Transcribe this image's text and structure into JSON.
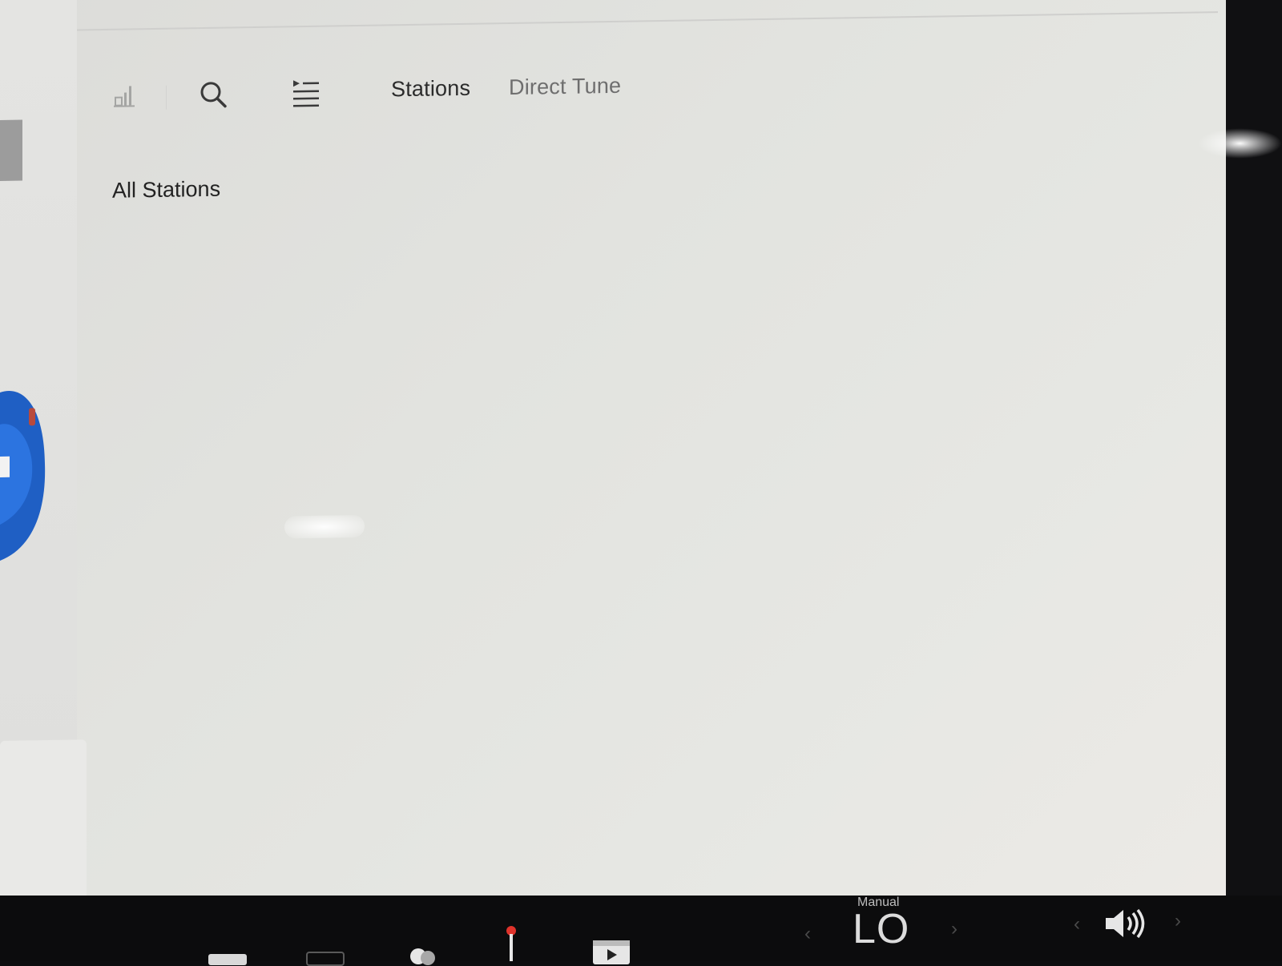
{
  "toolbar": {
    "icons": [
      "equalizer-icon",
      "search-icon",
      "queue-icon"
    ],
    "tabs": [
      {
        "label": "Stations",
        "active": true
      },
      {
        "label": "Direct Tune",
        "active": false
      }
    ]
  },
  "content": {
    "section_heading": "All Stations"
  },
  "bottom_bar": {
    "climate": {
      "mode_label": "Manual",
      "temperature": "LO"
    },
    "volume_icon": "speaker-volume-icon"
  },
  "colors": {
    "screen_background": "#e2e3df",
    "active_tab_text": "#2b2b2b",
    "inactive_tab_text": "#6e6e6e",
    "bezel": "#0c0c0d",
    "car_body": "#1f5fc4"
  }
}
